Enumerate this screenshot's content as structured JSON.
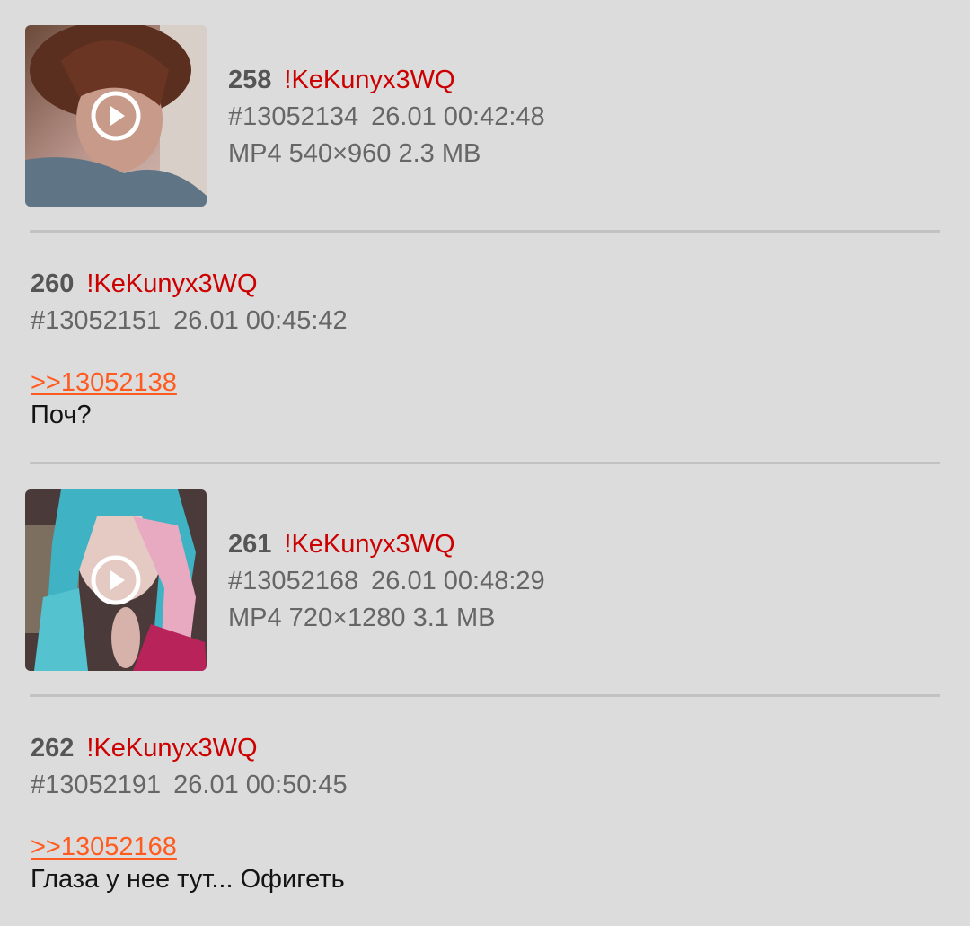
{
  "posts": [
    {
      "number": "258",
      "author": "!KeKunyx3WQ",
      "post_id": "#13052134",
      "datetime": "26.01 00:42:48",
      "file_info": "MP4 540×960 2.3 MB",
      "thumbnail_icon": "play-icon"
    },
    {
      "number": "260",
      "author": "!KeKunyx3WQ",
      "post_id": "#13052151",
      "datetime": "26.01 00:45:42",
      "reply_link": ">>13052138",
      "text": "Поч?"
    },
    {
      "number": "261",
      "author": "!KeKunyx3WQ",
      "post_id": "#13052168",
      "datetime": "26.01 00:48:29",
      "file_info": "MP4 720×1280 3.1 MB",
      "thumbnail_icon": "play-icon"
    },
    {
      "number": "262",
      "author": "!KeKunyx3WQ",
      "post_id": "#13052191",
      "datetime": "26.01 00:50:45",
      "reply_link": ">>13052168",
      "text": "Глаза у нее тут... Офигеть"
    }
  ],
  "colors": {
    "background": "#dcdcdc",
    "divider": "#c2c2c2",
    "author": "#cc0000",
    "reply_link": "#ff5a1f",
    "post_number": "#555555",
    "meta": "#666666"
  }
}
